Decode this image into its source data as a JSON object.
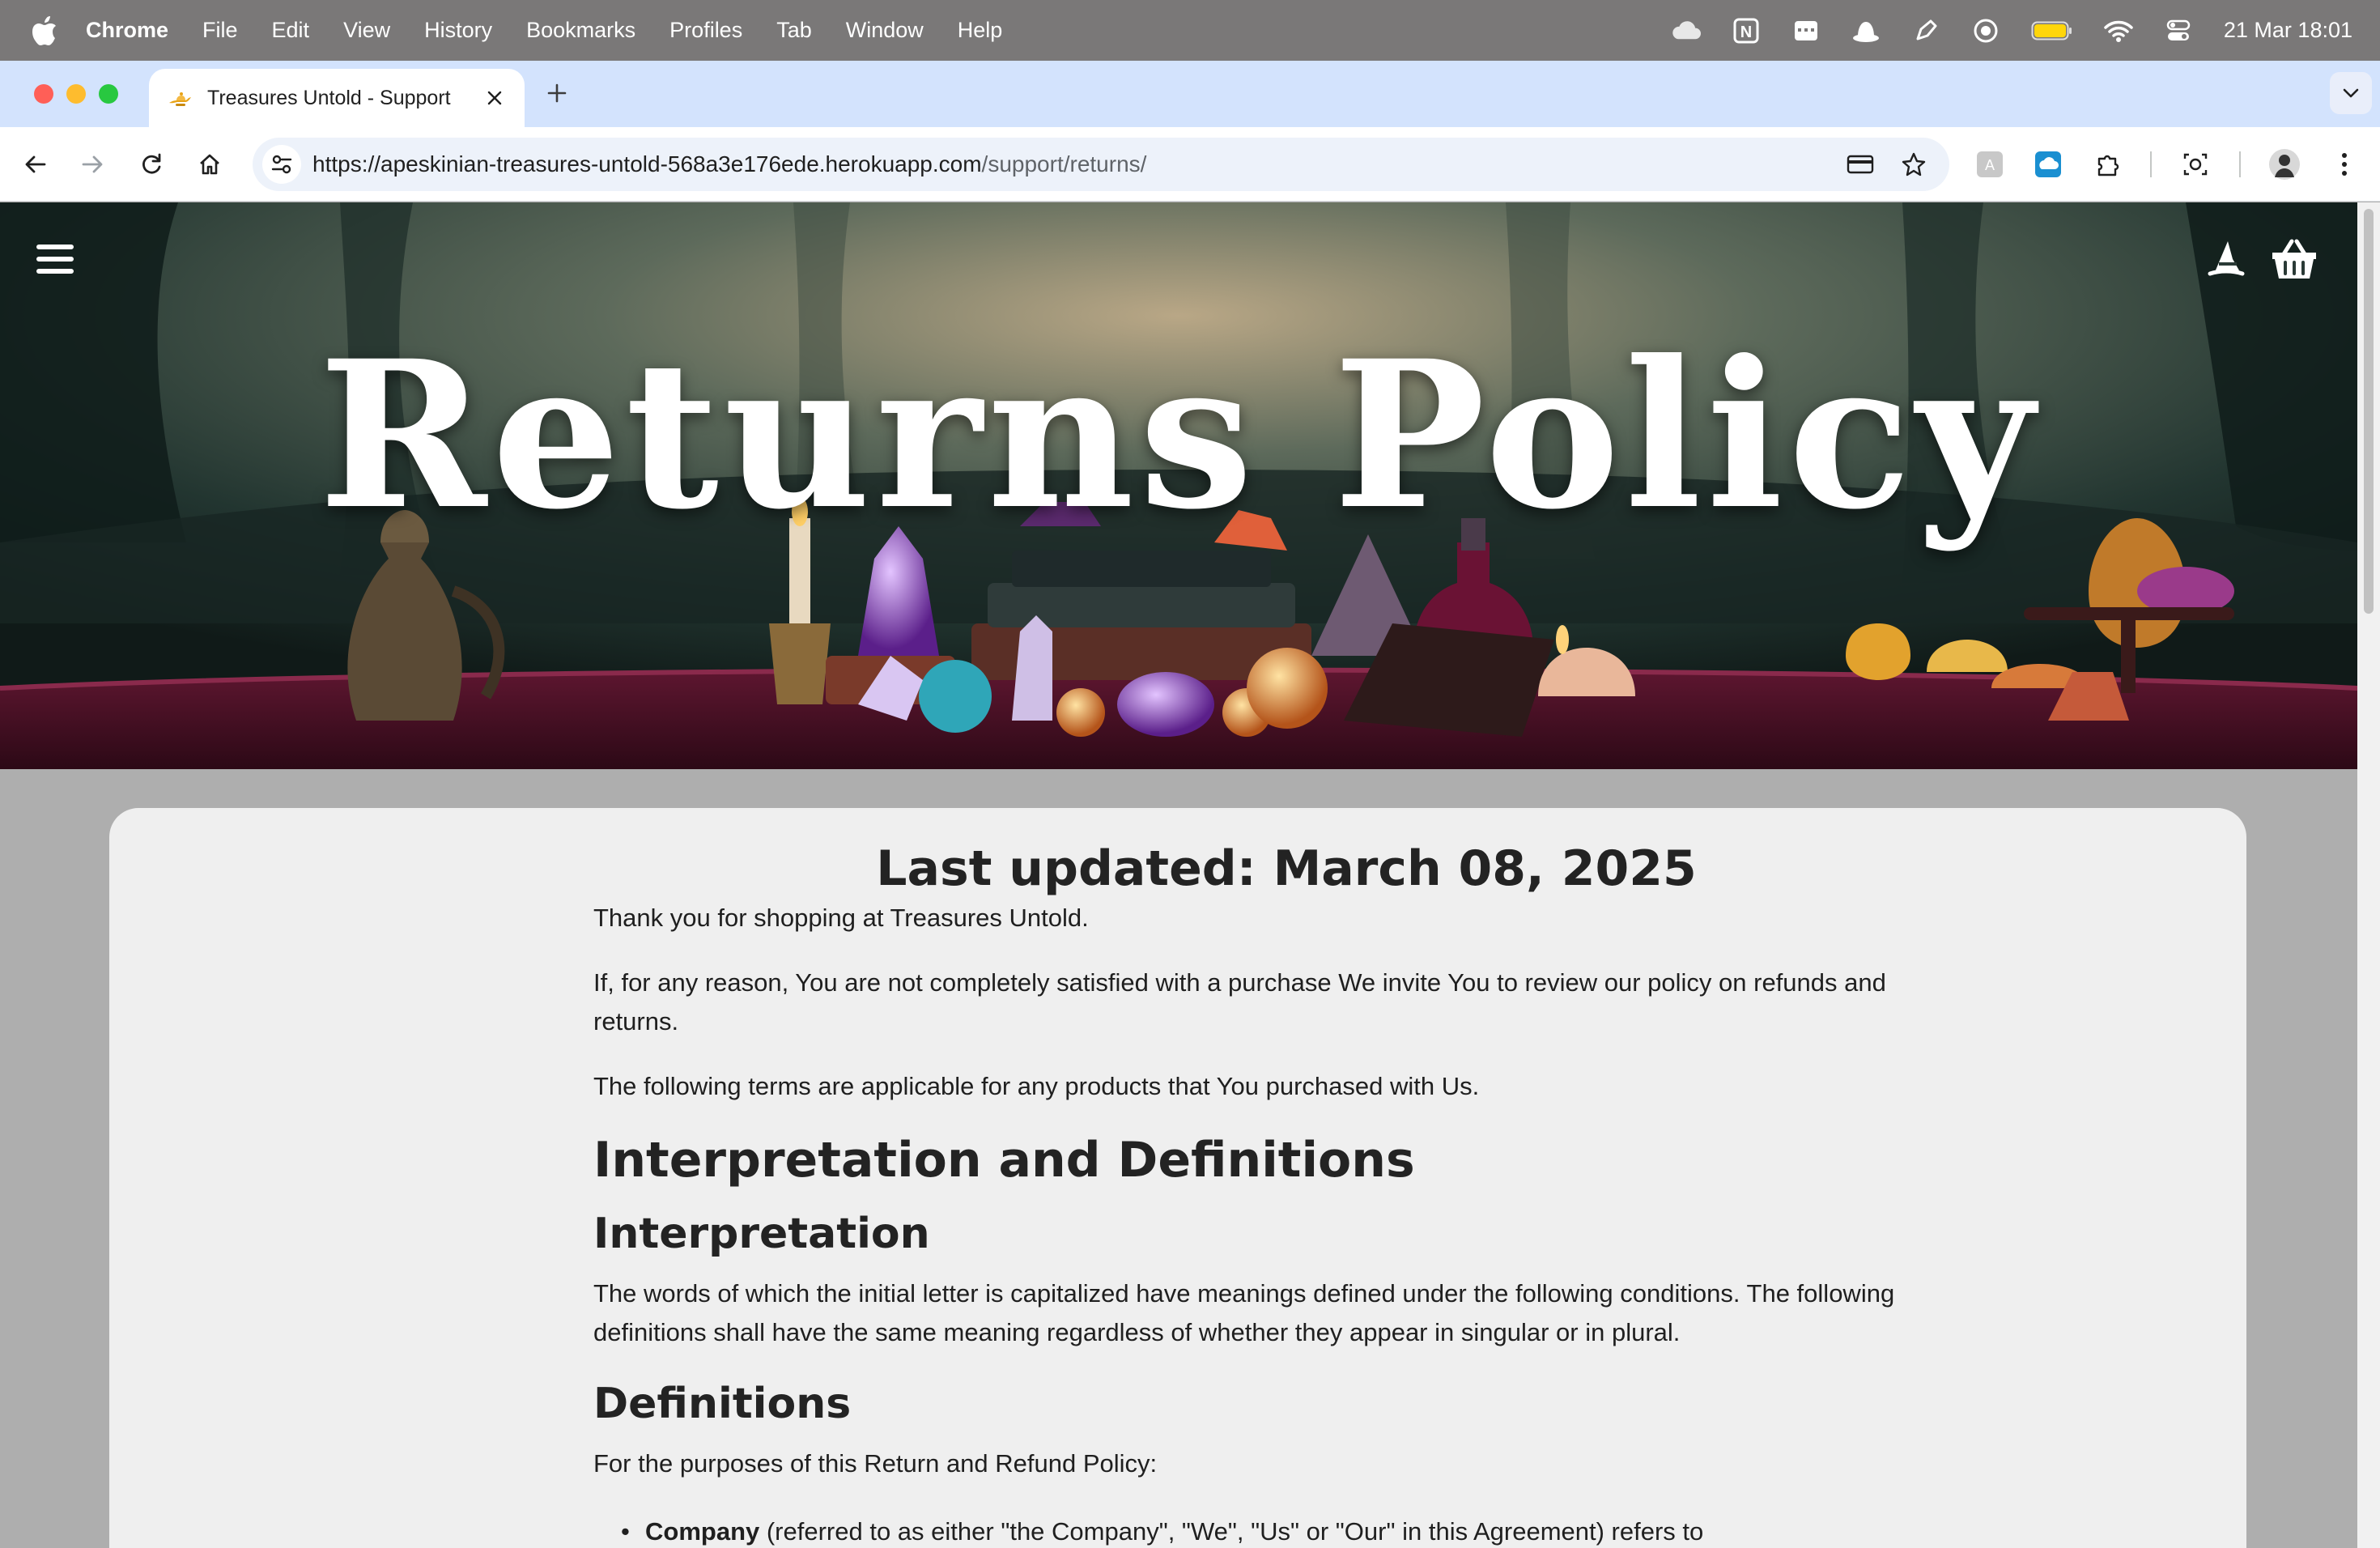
{
  "menubar": {
    "app_name": "Chrome",
    "items": [
      "File",
      "Edit",
      "View",
      "History",
      "Bookmarks",
      "Profiles",
      "Tab",
      "Window",
      "Help"
    ],
    "clock": "21 Mar  18:01"
  },
  "browser": {
    "tab_title": "Treasures Untold - Support",
    "url_host": "https://apeskinian-treasures-untold-568a3e176ede.herokuapp.com",
    "url_path": "/support/returns/"
  },
  "hero": {
    "title": "Returns Policy"
  },
  "article": {
    "last_updated": "Last updated: March 08, 2025",
    "intro_1": "Thank you for shopping at Treasures Untold.",
    "intro_2a": "If, for any reason, You are not completely satisfied with a purchase We invite You to review our policy on refunds and",
    "intro_2b": "returns.",
    "intro_3": "The following terms are applicable for any products that You purchased with Us.",
    "h_interp_defs": "Interpretation and Definitions",
    "h_interpretation": "Interpretation",
    "interp_1a": "The words of which the initial letter is capitalized have meanings defined under the following conditions. The following",
    "interp_1b": "definitions shall have the same meaning regardless of whether they appear in singular or in plural.",
    "h_definitions": "Definitions",
    "defs_intro": "For the purposes of this Return and Refund Policy:",
    "def_company_term": "Company",
    "def_company_text": " (referred to as either \"the Company\", \"We\", \"Us\" or \"Our\" in this Agreement) refers to"
  }
}
